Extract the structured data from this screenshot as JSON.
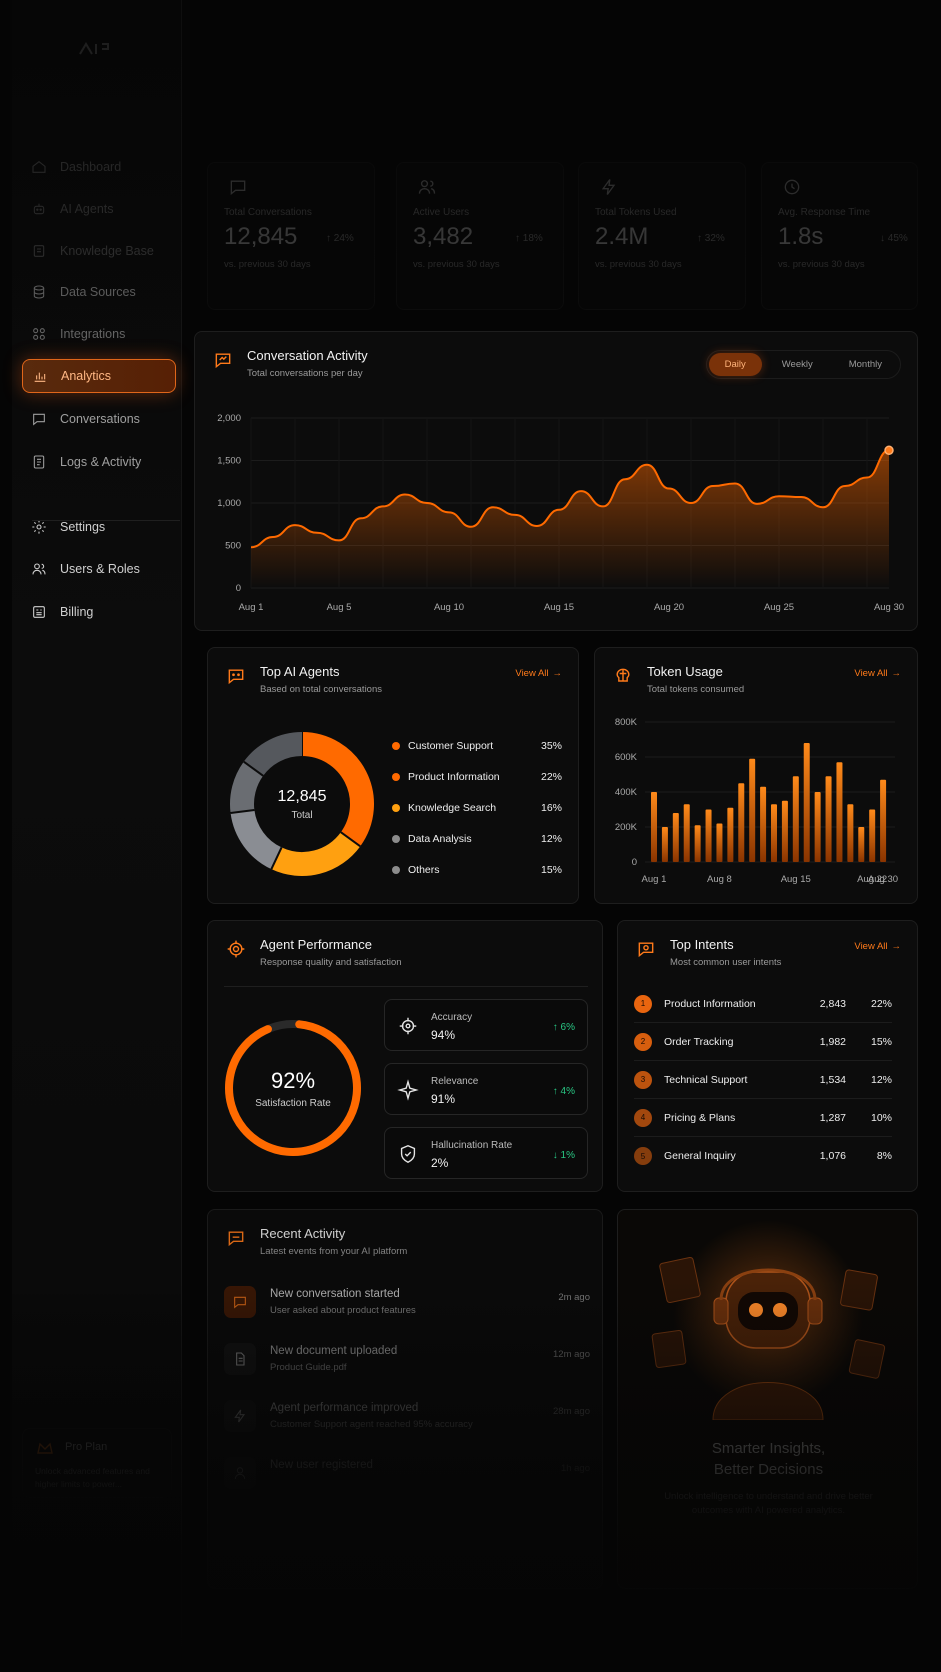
{
  "colors": {
    "accent": "#ff7a1a",
    "accent_dark": "#7a3209",
    "positive": "#29c784",
    "bg": "#050505",
    "card": "#0c0c0c"
  },
  "sidebar": {
    "items": [
      {
        "label": "Dashboard",
        "icon": "home-icon"
      },
      {
        "label": "AI Agents",
        "icon": "bot-icon"
      },
      {
        "label": "Knowledge Base",
        "icon": "book-icon"
      },
      {
        "label": "Data Sources",
        "icon": "database-icon"
      },
      {
        "label": "Integrations",
        "icon": "grid-icon"
      },
      {
        "label": "Analytics",
        "icon": "bar-chart-icon",
        "active": true
      },
      {
        "label": "Conversations",
        "icon": "chat-icon"
      },
      {
        "label": "Logs & Activity",
        "icon": "list-icon"
      },
      {
        "label": "Settings",
        "icon": "gear-icon"
      },
      {
        "label": "Users & Roles",
        "icon": "users-icon"
      },
      {
        "label": "Billing",
        "icon": "billing-icon"
      }
    ],
    "plan": {
      "title": "Pro Plan",
      "text": "Unlock advanced features and higher limits to power..."
    }
  },
  "stats": [
    {
      "label": "Total Conversations",
      "value": "12,845",
      "delta": "↑ 24%",
      "compare": "vs. previous 30 days",
      "icon": "chat-icon"
    },
    {
      "label": "Active Users",
      "value": "3,482",
      "delta": "↑ 18%",
      "compare": "vs. previous 30 days",
      "icon": "users-icon"
    },
    {
      "label": "Total Tokens Used",
      "value": "2.4M",
      "delta": "↑ 32%",
      "compare": "vs. previous 30 days",
      "icon": "bolt-icon"
    },
    {
      "label": "Avg. Response Time",
      "value": "1.8s",
      "delta": "↓ 45%",
      "compare": "vs. previous 30 days",
      "icon": "clock-icon"
    }
  ],
  "conversation_activity": {
    "title": "Conversation Activity",
    "subtitle": "Total conversations per day",
    "tabs": [
      "Daily",
      "Weekly",
      "Monthly"
    ],
    "active_tab": "Daily"
  },
  "top_agents": {
    "title": "Top AI Agents",
    "subtitle": "Based on total conversations",
    "view_all": "View All",
    "center_value": "12,845",
    "center_label": "Total"
  },
  "token_usage": {
    "title": "Token Usage",
    "subtitle": "Total tokens consumed",
    "view_all": "View All"
  },
  "agent_performance": {
    "title": "Agent Performance",
    "subtitle": "Response quality and satisfaction",
    "satisfaction": 0.92,
    "satisfaction_value": "92%",
    "satisfaction_label": "Satisfaction Rate",
    "metrics": [
      {
        "label": "Accuracy",
        "value": "94%",
        "delta": "↑ 6%",
        "icon": "target-icon"
      },
      {
        "label": "Relevance",
        "value": "91%",
        "delta": "↑ 4%",
        "icon": "sparkle-icon"
      },
      {
        "label": "Hallucination Rate",
        "value": "2%",
        "delta": "↓ 1%",
        "icon": "shield-icon"
      }
    ]
  },
  "top_intents": {
    "title": "Top Intents",
    "subtitle": "Most common user intents",
    "view_all": "View All",
    "rows": [
      {
        "rank": "1",
        "name": "Product Information",
        "count": "2,843",
        "pct": "22%"
      },
      {
        "rank": "2",
        "name": "Order Tracking",
        "count": "1,982",
        "pct": "15%"
      },
      {
        "rank": "3",
        "name": "Technical Support",
        "count": "1,534",
        "pct": "12%"
      },
      {
        "rank": "4",
        "name": "Pricing & Plans",
        "count": "1,287",
        "pct": "10%"
      },
      {
        "rank": "5",
        "name": "General Inquiry",
        "count": "1,076",
        "pct": "8%"
      }
    ]
  },
  "recent_activity": {
    "title": "Recent Activity",
    "subtitle": "Latest events from your AI platform",
    "items": [
      {
        "title": "New conversation started",
        "desc": "User asked about product features",
        "time": "2m ago",
        "icon": "chat-icon"
      },
      {
        "title": "New document uploaded",
        "desc": "Product Guide.pdf",
        "time": "12m ago",
        "icon": "document-icon"
      },
      {
        "title": "Agent performance improved",
        "desc": "Customer Support agent reached 95% accuracy",
        "time": "28m ago",
        "icon": "bolt-icon"
      },
      {
        "title": "New user registered",
        "desc": "",
        "time": "1h ago",
        "icon": "user-icon"
      }
    ]
  },
  "promo": {
    "title_line1": "Smarter Insights,",
    "title_line2": "Better Decisions",
    "text": "Unlock intelligence to understand and drive better outcomes with AI powered analytics."
  },
  "chart_data": [
    {
      "type": "area",
      "title": "Conversation Activity",
      "x": [
        "Aug 1",
        "Aug 2",
        "Aug 3",
        "Aug 4",
        "Aug 5",
        "Aug 6",
        "Aug 7",
        "Aug 8",
        "Aug 9",
        "Aug 10",
        "Aug 11",
        "Aug 12",
        "Aug 13",
        "Aug 14",
        "Aug 15",
        "Aug 16",
        "Aug 17",
        "Aug 18",
        "Aug 19",
        "Aug 20",
        "Aug 21",
        "Aug 22",
        "Aug 23",
        "Aug 24",
        "Aug 25",
        "Aug 26",
        "Aug 27",
        "Aug 28",
        "Aug 29",
        "Aug 30"
      ],
      "x_ticks": [
        "Aug 1",
        "Aug 5",
        "Aug 10",
        "Aug 15",
        "Aug 20",
        "Aug 25",
        "Aug 30"
      ],
      "values": [
        480,
        600,
        740,
        650,
        560,
        820,
        960,
        1100,
        1000,
        890,
        720,
        950,
        860,
        730,
        920,
        1140,
        960,
        1280,
        1450,
        1170,
        1000,
        1200,
        1230,
        990,
        1080,
        1070,
        950,
        1200,
        1300,
        1620
      ],
      "ylim": [
        0,
        2000
      ],
      "y_ticks": [
        "0",
        "500",
        "1,000",
        "1,500",
        "2,000"
      ],
      "grid": true
    },
    {
      "type": "pie",
      "title": "Top AI Agents",
      "labels": [
        "Customer Support",
        "Product Information",
        "Knowledge Search",
        "Data Analysis",
        "Others"
      ],
      "values": [
        35,
        22,
        16,
        12,
        15
      ],
      "display": [
        "35%",
        "22%",
        "16%",
        "12%",
        "15%"
      ],
      "colors": [
        "#ff6a00",
        "#ff6a00",
        "#ffa010",
        "#8c8c8c",
        "#8c8c8c"
      ],
      "segment_colors": [
        "#ff6a00",
        "#ffa010",
        "#8a8d93",
        "#6a6d72",
        "#55585d"
      ]
    },
    {
      "type": "bar",
      "title": "Token Usage",
      "categories": [
        "Aug 1",
        "Aug 2",
        "Aug 3",
        "Aug 4",
        "Aug 5",
        "Aug 6",
        "Aug 7",
        "Aug 8",
        "Aug 9",
        "Aug 10",
        "Aug 11",
        "Aug 12",
        "Aug 13",
        "Aug 14",
        "Aug 15",
        "Aug 16",
        "Aug 17",
        "Aug 18",
        "Aug 19",
        "Aug 20",
        "Aug 21",
        "Aug 22"
      ],
      "x_ticks": [
        "Aug 1",
        "Aug 8",
        "Aug 15",
        "Aug 22",
        "Aug 30"
      ],
      "values": [
        400000,
        200000,
        280000,
        330000,
        210000,
        300000,
        220000,
        310000,
        450000,
        590000,
        430000,
        330000,
        350000,
        490000,
        680000,
        400000,
        490000,
        570000,
        330000,
        200000,
        300000,
        470000
      ],
      "ylim": [
        0,
        800000
      ],
      "y_ticks": [
        "0",
        "200K",
        "400K",
        "600K",
        "800K"
      ]
    }
  ]
}
